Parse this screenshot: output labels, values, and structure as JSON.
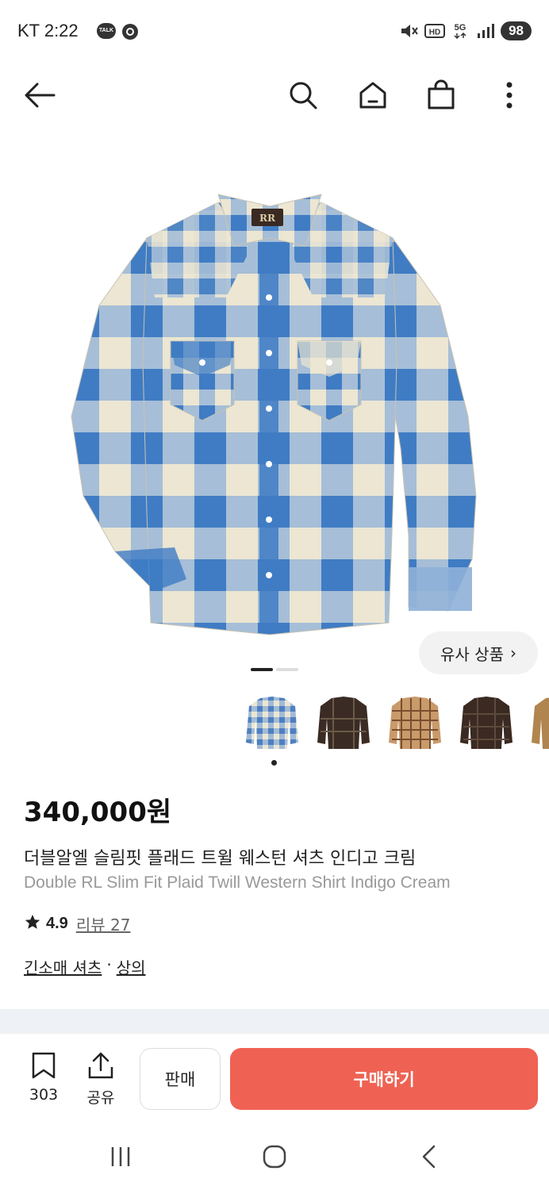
{
  "status_bar": {
    "carrier_time": "KT 2:22",
    "talk_badge": "TALK",
    "battery": "98",
    "icons": [
      "talk-icon",
      "at-sign-icon",
      "mute-icon",
      "hd-icon",
      "5g-icon",
      "signal-icon",
      "battery-icon"
    ]
  },
  "header": {
    "icons": [
      "back-arrow-icon",
      "search-icon",
      "home-icon",
      "shopping-bag-icon",
      "more-vertical-icon"
    ]
  },
  "gallery": {
    "similar_label": "유사 상품",
    "similar_chevron": "›",
    "current_page": 1,
    "total_pages": 2,
    "thumbnail_colors": [
      "#4f7fbf",
      "#3a2c24",
      "#b07b4e",
      "#3a2a22",
      "#b0854f"
    ]
  },
  "product": {
    "price": "340,000원",
    "title_ko": "더블알엘 슬림핏 플래드 트윌 웨스턴 셔츠 인디고 크림",
    "title_en": "Double RL Slim Fit Plaid Twill Western Shirt Indigo Cream",
    "rating": "4.9",
    "reviews_label": "리뷰 27",
    "category_1": "긴소매 셔츠",
    "category_sep": "·",
    "category_2": "상의"
  },
  "actions": {
    "wishlist_count": "303",
    "share_label": "공유",
    "sell_label": "판매",
    "buy_label": "구매하기"
  },
  "colors": {
    "buy_button": "#ef6253",
    "shirt_blue": "#3f7cc4",
    "shirt_cream": "#ece6d2"
  }
}
